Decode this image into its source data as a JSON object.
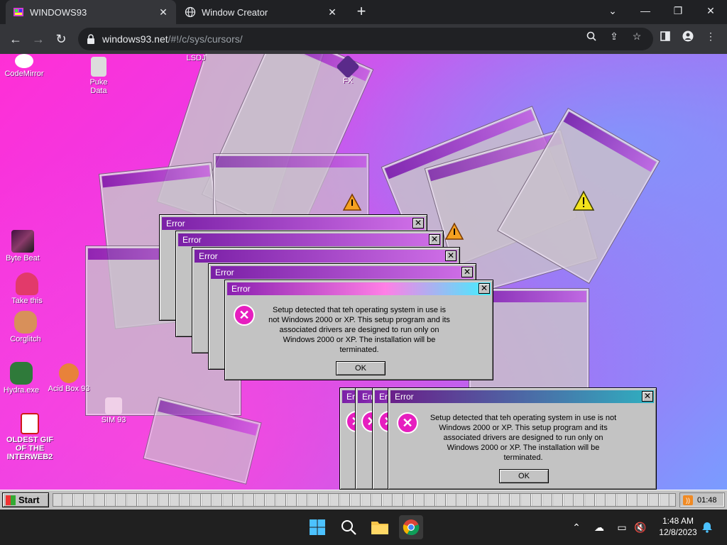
{
  "browser": {
    "tabs": [
      {
        "title": "WINDOWS93",
        "active": true
      },
      {
        "title": "Window Creator",
        "active": false
      }
    ],
    "url_host": "windows93.net",
    "url_path": "/#!/c/sys/cursors/"
  },
  "desktop": {
    "icons": [
      {
        "label": "CodeMirror"
      },
      {
        "label": "Byte Beat"
      },
      {
        "label": "Take this"
      },
      {
        "label": "Corglitch"
      },
      {
        "label": "Hydra.exe"
      },
      {
        "label": "Acid Box 93"
      },
      {
        "label": "OLDEST GIF OF THE INTERWEB2"
      },
      {
        "label": "SIM 93"
      },
      {
        "label": "LSDJ"
      },
      {
        "label": "FX"
      },
      {
        "label": "Puke Data"
      }
    ]
  },
  "error_dialog": {
    "title": "Error",
    "message": "Setup detected that teh operating system in use is not Windows 2000 or XP. This setup program and its associated drivers are designed to run only on Windows 2000 or XP. The installation will be terminated.",
    "ok_label": "OK",
    "close_glyph": "✕",
    "icon_glyph": "✕"
  },
  "taskbar93": {
    "start_label": "Start",
    "tray_time": "01:48"
  },
  "windows_taskbar": {
    "time": "1:48 AM",
    "date": "12/8/2023"
  },
  "colors": {
    "accent_magenta": "#e61fbf",
    "title_purple": "#7a1fa6"
  }
}
